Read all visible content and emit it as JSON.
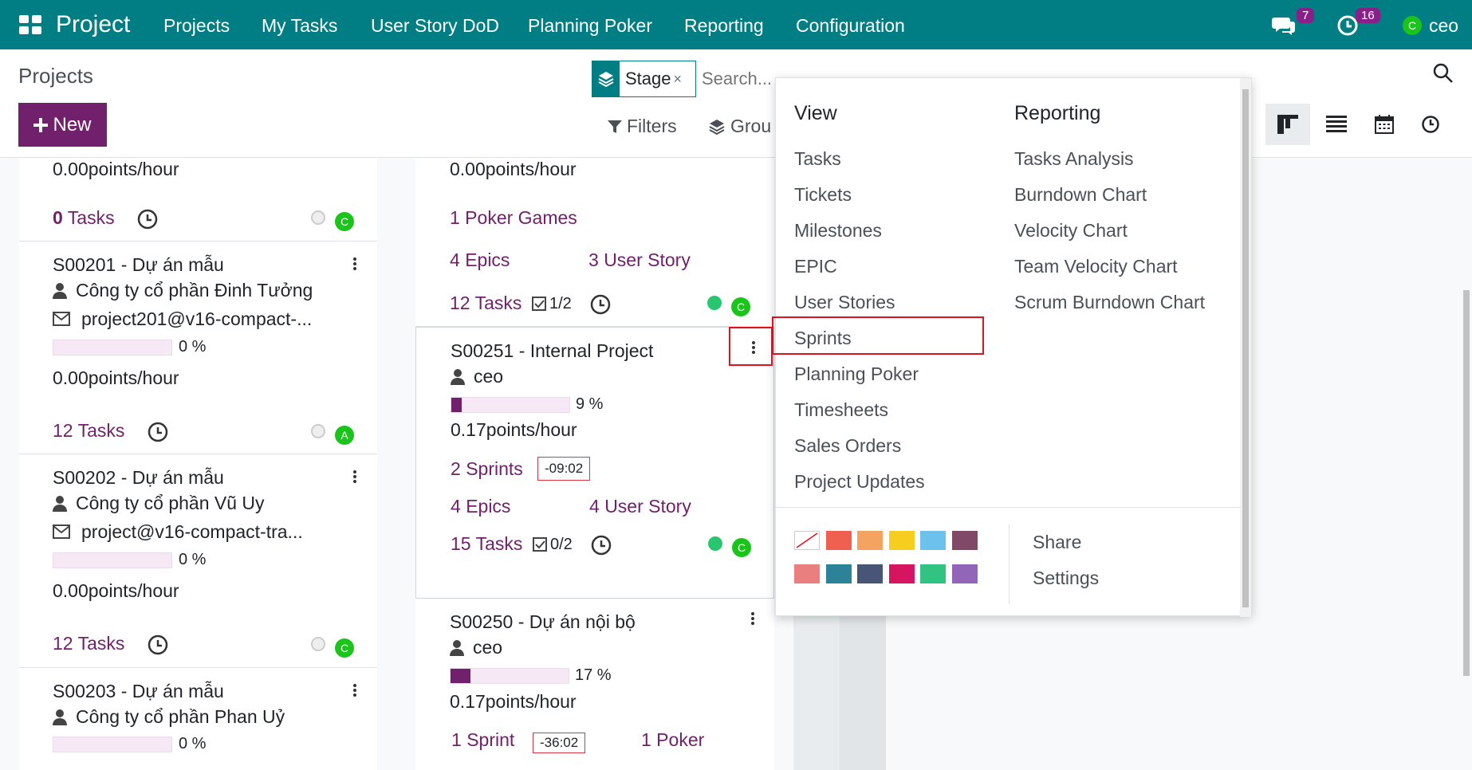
{
  "topbar": {
    "brand": "Project",
    "menu": [
      "Projects",
      "My Tasks",
      "User Story DoD",
      "Planning Poker",
      "Reporting",
      "Configuration"
    ],
    "messages_count": "7",
    "activities_count": "16",
    "user_initial": "C",
    "user_name": "ceo"
  },
  "control": {
    "title": "Projects",
    "new_label": "New",
    "facet_label": "Stage",
    "search_placeholder": "Search...",
    "filters_label": "Filters",
    "groupby_label": "Grou"
  },
  "columns": {
    "left": {
      "top_card": {
        "rate": "0.00points/hour",
        "tasks_count": "0",
        "tasks_label": "Tasks",
        "avatar": "C"
      },
      "cards": [
        {
          "title": "S00201 - Dự án mẫu",
          "customer": "Công ty cổ phần Đinh Tưởng",
          "email": "project201@v16-compact-...",
          "progress": 0,
          "progress_text": "0 %",
          "rate": "0.00points/hour",
          "tasks_count": "12",
          "tasks_label": "Tasks",
          "avatar": "A"
        },
        {
          "title": "S00202 - Dự án mẫu",
          "customer": "Công ty cổ phần Vũ Uy",
          "email": "project@v16-compact-tra...",
          "progress": 0,
          "progress_text": "0 %",
          "rate": "0.00points/hour",
          "tasks_count": "12",
          "tasks_label": "Tasks",
          "avatar": "C"
        },
        {
          "title": "S00203 - Dự án mẫu",
          "customer": "Công ty cổ phần Phan Uỷ",
          "progress": 0,
          "progress_text": "0 %"
        }
      ]
    },
    "mid": {
      "top_card": {
        "rate": "0.00points/hour",
        "poker": "1 Poker Games",
        "epics_count": "4",
        "epics_label": "Epics",
        "stories_count": "3",
        "stories_label": "User Story",
        "tasks_count": "12",
        "tasks_label": "Tasks",
        "checklist": "1/2",
        "avatar": "C"
      },
      "internal": {
        "title": "S00251 - Internal Project",
        "user": "ceo",
        "progress": 9,
        "progress_text": "9 %",
        "rate": "0.17points/hour",
        "sprints_count": "2",
        "sprints_label": "Sprints",
        "timer": "-09:02",
        "epics_count": "4",
        "epics_label": "Epics",
        "stories_count": "4",
        "stories_label": "User Story",
        "tasks_count": "15",
        "tasks_label": "Tasks",
        "checklist": "0/2",
        "avatar": "C"
      },
      "next": {
        "title": "S00250 - Dự án nội bộ",
        "user": "ceo",
        "progress": 17,
        "progress_text": "17 %",
        "rate": "0.17points/hour",
        "sprints_count": "1",
        "sprints_label": "Sprint",
        "timer": "-36:02",
        "poker": "1 Poker"
      }
    }
  },
  "dropdown": {
    "view_heading": "View",
    "view_items": [
      "Tasks",
      "Tickets",
      "Milestones",
      "EPIC",
      "User Stories",
      "Sprints",
      "Planning Poker",
      "Timesheets",
      "Sales Orders",
      "Project Updates"
    ],
    "reporting_heading": "Reporting",
    "reporting_items": [
      "Tasks Analysis",
      "Burndown Chart",
      "Velocity Chart",
      "Team Velocity Chart",
      "Scrum Burndown Chart"
    ],
    "colors": [
      "none",
      "#f06050",
      "#f4a460",
      "#f7cd1f",
      "#6cc1ed",
      "#814968",
      "#eb7e7f",
      "#2c8397",
      "#475577",
      "#d6145f",
      "#30c381",
      "#9365b8"
    ],
    "share_label": "Share",
    "settings_label": "Settings"
  }
}
